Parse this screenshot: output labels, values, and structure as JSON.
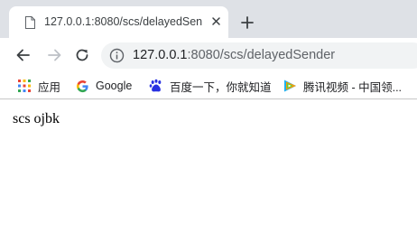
{
  "tab": {
    "title": "127.0.0.1:8080/scs/delayedSen"
  },
  "omnibox": {
    "host": "127.0.0.1",
    "rest": ":8080/scs/delayedSender"
  },
  "bookmarks": [
    {
      "label": "应用",
      "icon": "apps-grid-icon"
    },
    {
      "label": "Google",
      "icon": "google-g-icon"
    },
    {
      "label": "百度一下，你就知道",
      "icon": "baidu-paw-icon"
    },
    {
      "label": "腾讯视频 - 中国领...",
      "icon": "tencent-video-icon"
    }
  ],
  "page": {
    "text": "scs ojbk"
  },
  "colors": {
    "tabstrip_bg": "#dee1e6",
    "omnibox_bg": "#f1f3f4",
    "baidu_blue": "#2932e1"
  }
}
